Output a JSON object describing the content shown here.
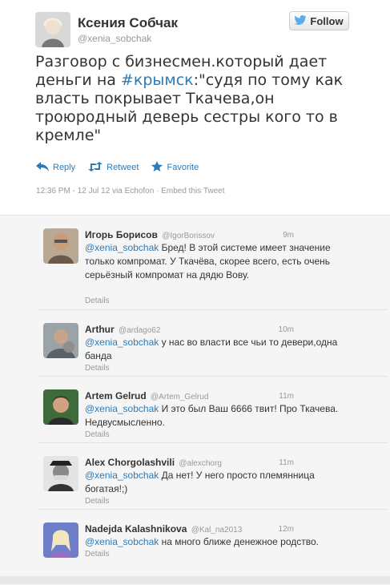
{
  "main_tweet": {
    "author_name": "Ксения Собчак",
    "author_handle": "@xenia_sobchak",
    "follow_label": "Follow",
    "text_before": "Разговор с бизнесмен.который дает деньги на ",
    "hashtag": "#крымск",
    "text_after": ":\"судя по тому как власть покрывает Ткачева,он троюродный деверь сестры кого то в кремле\"",
    "actions": {
      "reply": "Reply",
      "retweet": "Retweet",
      "favorite": "Favorite"
    },
    "meta": "12:36 PM - 12 Jul 12 via Echofon · Embed this Tweet"
  },
  "replies": [
    {
      "name": "Игорь Борисов",
      "handle": "@IgorBorissov",
      "time": "9m",
      "mention": "@xenia_sobchak",
      "text": " Бред! В этой системе имеет значение только компромат. У Ткачёва, скорее всего, есть очень серьёзный компромат на дядю Вову.",
      "details": "Details"
    },
    {
      "name": "Arthur",
      "handle": "@ardago62",
      "time": "10m",
      "mention": "@xenia_sobchak",
      "text": " у нас во власти все чьи то девери,одна банда",
      "details": "Details"
    },
    {
      "name": "Artem Gelrud",
      "handle": "@Artem_Gelrud",
      "time": "11m",
      "mention": "@xenia_sobchak",
      "text": " И это был Ваш 6666 твит! Про Ткачева. Недвусмысленно.",
      "details": "Details"
    },
    {
      "name": "Alex Chorgolashvili",
      "handle": "@alexchorg",
      "time": "11m",
      "mention": "@xenia_sobchak",
      "text": " Да нет! У него просто племянница богатая!;)",
      "details": "Details"
    },
    {
      "name": "Nadejda Kalashnikova",
      "handle": "@Kal_na2013",
      "time": "12m",
      "mention": "@xenia_sobchak",
      "text": " на много ближе денежное родство.",
      "details": "Details"
    }
  ],
  "colors": {
    "link": "#2b7bb9",
    "muted": "#999999",
    "reply_bg": "#f5f5f5"
  }
}
